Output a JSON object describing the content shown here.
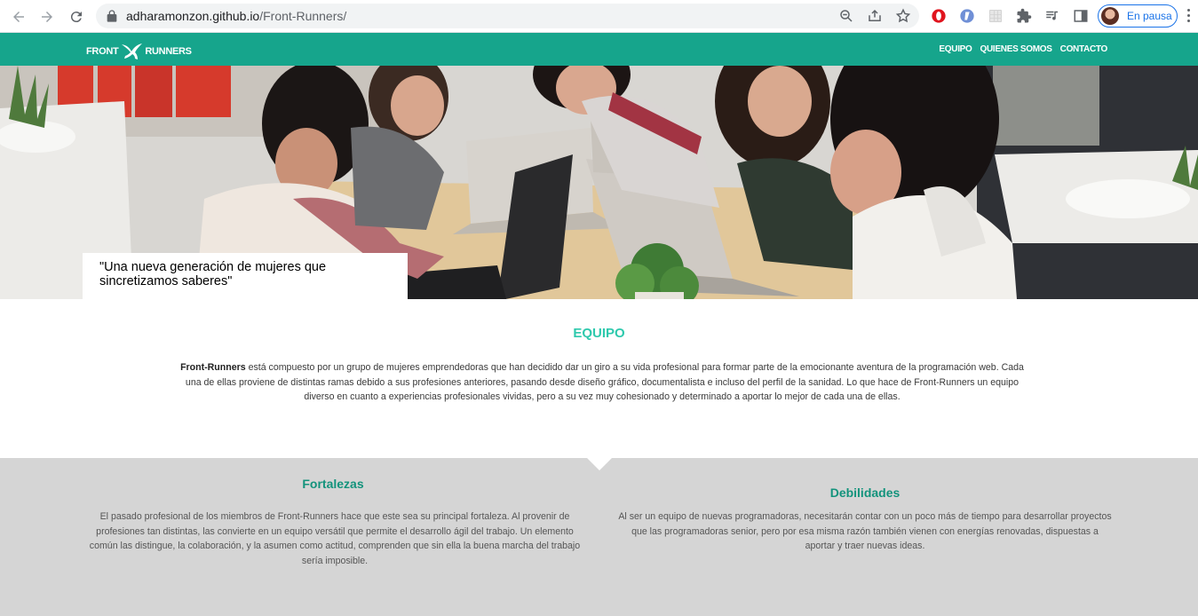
{
  "browser": {
    "url_host": "adharamonzon.github.io",
    "url_path": "/Front-Runners/",
    "profile_label": "En pausa"
  },
  "site": {
    "logo_left": "FRONT",
    "logo_right": "RUNNERS",
    "nav": [
      "EQUIPO",
      "QUIENES SOMOS",
      "CONTACTO"
    ]
  },
  "hero": {
    "quote": "\"Una nueva generación de mujeres que sincretizamos saberes\""
  },
  "equipo": {
    "title": "EQUIPO",
    "brand": "Front-Runners",
    "text": " está compuesto por un grupo de mujeres emprendedoras que han decidido dar un giro a su vida profesional para formar parte de la emocionante aventura de la programación web. Cada una de ellas proviene de distintas ramas debido a sus profesiones anteriores, pasando desde diseño gráfico, documentalista e incluso del perfil de la sanidad. Lo que hace de Front-Runners un equipo diverso en cuanto a experiencias profesionales vividas, pero a su vez muy cohesionado y determinado a aportar lo mejor de cada una de ellas."
  },
  "fortalezas": {
    "title": "Fortalezas",
    "text": "El pasado profesional de los miembros de Front-Runners hace que este sea su principal fortaleza. Al provenir de profesiones tan distintas, las convierte en un equipo versátil que permite el desarrollo ágil del trabajo. Un elemento común las distingue, la colaboración, y la asumen como actitud, comprenden que sin ella la buena marcha del trabajo sería imposible."
  },
  "debilidades": {
    "title": "Debilidades",
    "text": "Al ser un equipo de nuevas programadoras, necesitarán contar con un poco más de tiempo para desarrollar proyectos que las programadoras senior, pero por esa misma razón también vienen con energías renovadas, dispuestas a aportar y traer nuevas ideas."
  },
  "colors": {
    "nav_bg": "#16a58c",
    "title_teal": "#2ec9ad",
    "section_gray": "#d5d5d5"
  }
}
